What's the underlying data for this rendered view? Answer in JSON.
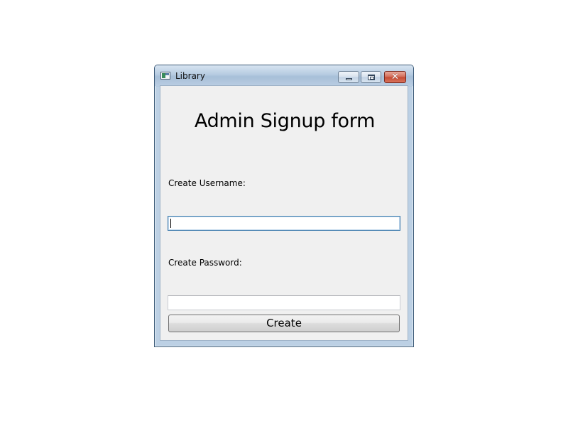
{
  "window": {
    "title": "Library",
    "controls": {
      "minimize_icon": "minimize-icon",
      "maximize_icon": "maximize-icon",
      "close_icon": "close-icon",
      "close_glyph": "✕"
    }
  },
  "form": {
    "heading": "Admin Signup form",
    "username_label": "Create Username:",
    "username_value": "",
    "password_label": "Create Password:",
    "password_value": "",
    "submit_label": "Create"
  },
  "colors": {
    "titlebar": "#b6cbe1",
    "client_background": "#f0f0f0",
    "close_button": "#c44a32",
    "focused_border": "#3d7bad"
  }
}
